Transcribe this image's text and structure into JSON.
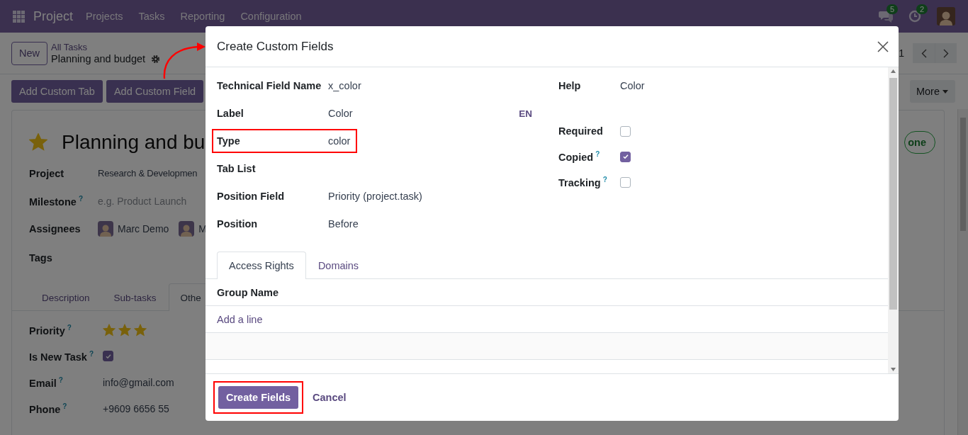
{
  "navbar": {
    "app": "Project",
    "menu": [
      "Projects",
      "Tasks",
      "Reporting",
      "Configuration"
    ],
    "messages_count": "5",
    "activities_count": "2"
  },
  "control_panel": {
    "new_button": "New",
    "breadcrumb": "All Tasks",
    "record": "Planning and budget",
    "pager": "1",
    "actions": [
      "Add Custom Tab",
      "Add Custom Field"
    ],
    "more": "More"
  },
  "task": {
    "starred": true,
    "title": "Planning and bu",
    "stage_button": "one",
    "fields": [
      {
        "label": "Project",
        "kind": "text",
        "value": "Research & Developmen"
      },
      {
        "label": "Milestone",
        "help_mark": "?",
        "kind": "placeholder",
        "placeholder": "e.g. Product Launch"
      },
      {
        "label": "Assignees",
        "kind": "users",
        "assignees": [
          "Marc Demo",
          "M"
        ]
      },
      {
        "label": "Tags",
        "kind": "empty"
      }
    ],
    "tabs": [
      {
        "label": "Description",
        "selected": false
      },
      {
        "label": "Sub-tasks",
        "selected": false
      },
      {
        "label": "Othe",
        "selected": true
      }
    ],
    "other_fields": [
      {
        "label": "Priority",
        "help_mark": "?",
        "kind": "stars",
        "stars": 3
      },
      {
        "label": "Is New Task",
        "help_mark": "?",
        "kind": "checkbox",
        "checked": true
      },
      {
        "label": "Email",
        "help_mark": "?",
        "kind": "text",
        "value": "info@gmail.com"
      },
      {
        "label": "Phone",
        "help_mark": "?",
        "kind": "text",
        "value": "+9609 6656 55"
      }
    ]
  },
  "dialog": {
    "title": "Create Custom Fields",
    "left_fields": [
      {
        "label": "Technical Field Name",
        "value": "x_color",
        "highlighted": false
      },
      {
        "label": "Label",
        "value": "Color",
        "lang": "EN",
        "highlighted": false
      },
      {
        "label": "Type",
        "value": "color",
        "highlighted": true
      },
      {
        "label": "Tab List",
        "highlighted": false
      },
      {
        "label": "Position Field",
        "value": "Priority (project.task)",
        "highlighted": false
      },
      {
        "label": "Position",
        "value": "Before",
        "highlighted": false
      }
    ],
    "right_fields": [
      {
        "label": "Help",
        "kind": "text",
        "value": "Color"
      },
      {
        "label": "Required",
        "kind": "checkbox",
        "checked": false
      },
      {
        "label": "Copied",
        "help_mark": "?",
        "kind": "checkbox",
        "checked": true
      },
      {
        "label": "Tracking",
        "help_mark": "?",
        "kind": "checkbox",
        "checked": false
      }
    ],
    "tabs": [
      {
        "label": "Access Rights",
        "selected": true
      },
      {
        "label": "Domains",
        "selected": false
      }
    ],
    "table": {
      "columns": [
        "Group Name"
      ],
      "add_line": "Add a line"
    },
    "buttons": [
      {
        "label": "Create Fields",
        "kind": "primary",
        "highlighted": true
      },
      {
        "label": "Cancel",
        "kind": "link",
        "highlighted": false
      }
    ]
  }
}
